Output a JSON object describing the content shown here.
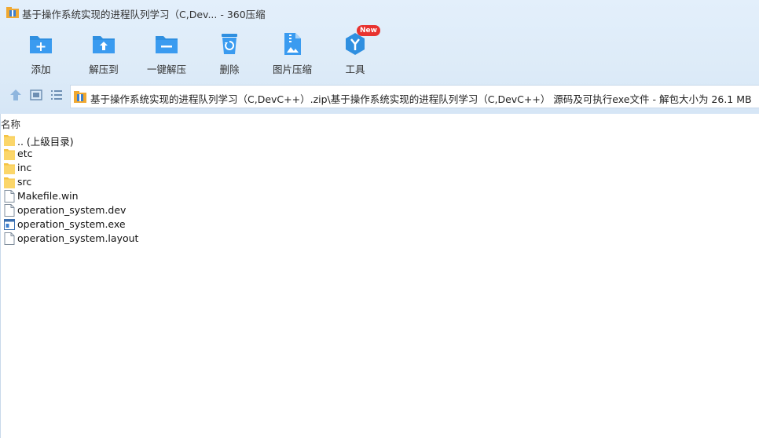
{
  "window": {
    "title": "基于操作系统实现的进程队列学习（C,Dev... - 360压缩"
  },
  "toolbar": {
    "buttons": [
      {
        "label": "添加",
        "icon": "add-folder-icon"
      },
      {
        "label": "解压到",
        "icon": "extract-to-icon"
      },
      {
        "label": "一键解压",
        "icon": "one-click-extract-icon"
      },
      {
        "label": "删除",
        "icon": "recycle-bin-icon"
      },
      {
        "label": "图片压缩",
        "icon": "image-compress-icon"
      },
      {
        "label": "工具",
        "icon": "tools-icon",
        "badge": "New"
      }
    ]
  },
  "address": {
    "path": "基于操作系统实现的进程队列学习（C,DevC++）.zip\\基于操作系统实现的进程队列学习（C,DevC++） 源码及可执行exe文件 - 解包大小为 26.1 MB"
  },
  "list": {
    "column_name": "名称",
    "items": [
      {
        "name": ".. (上级目录)",
        "type": "folder"
      },
      {
        "name": "etc",
        "type": "folder"
      },
      {
        "name": "inc",
        "type": "folder"
      },
      {
        "name": "src",
        "type": "folder"
      },
      {
        "name": "Makefile.win",
        "type": "file"
      },
      {
        "name": "operation_system.dev",
        "type": "file"
      },
      {
        "name": "operation_system.exe",
        "type": "exe"
      },
      {
        "name": "operation_system.layout",
        "type": "file"
      }
    ]
  },
  "colors": {
    "accent": "#2f8fe0",
    "folder": "#f5c342",
    "badge": "#e8322f"
  }
}
